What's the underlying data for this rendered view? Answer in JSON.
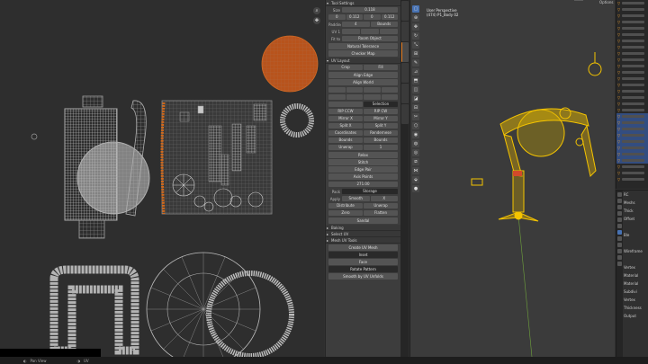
{
  "uv_editor": {
    "header_icons": [
      "zoom-icon",
      "pan-icon"
    ]
  },
  "n_panel": {
    "tool_header": "Tool Settings",
    "rows": [
      {
        "kind": "fields",
        "label": "Size",
        "values": [
          "0.118"
        ]
      },
      {
        "kind": "fields",
        "label": "",
        "values": [
          "0",
          "0.112",
          "0",
          "0.112"
        ]
      },
      {
        "kind": "fields",
        "label": "Padding",
        "values": [
          "4",
          "Bounds"
        ]
      },
      {
        "kind": "fields",
        "label": "UV 1",
        "values": [
          "",
          "",
          ""
        ]
      },
      {
        "kind": "fields",
        "label": "Fit to",
        "values": [
          "Room Object"
        ]
      },
      {
        "kind": "button",
        "label": "Natural Tolerance"
      },
      {
        "kind": "button",
        "label": "Checker Map"
      },
      {
        "kind": "header",
        "label": "UV Layout"
      },
      {
        "kind": "fields",
        "label": "",
        "values": [
          "Crop",
          "Fill"
        ]
      },
      {
        "kind": "button",
        "label": "Align Edge"
      },
      {
        "kind": "button",
        "label": "Align World"
      },
      {
        "kind": "fields",
        "label": "",
        "values": [
          "",
          "",
          "",
          ""
        ]
      },
      {
        "kind": "fields",
        "label": "",
        "values": [
          "",
          "",
          "",
          ""
        ]
      },
      {
        "kind": "fields",
        "label": "",
        "values": [
          "",
          "Selection"
        ]
      },
      {
        "kind": "fields",
        "label": "",
        "values": [
          "RIP CCW",
          "RIP CW"
        ]
      },
      {
        "kind": "fields",
        "label": "",
        "values": [
          "Mirror X",
          "Mirror Y"
        ]
      },
      {
        "kind": "fields",
        "label": "",
        "values": [
          "Split X",
          "Split Y"
        ]
      },
      {
        "kind": "fields",
        "label": "",
        "values": [
          "Coordinates",
          "Rendernese"
        ]
      },
      {
        "kind": "fields",
        "label": "",
        "values": [
          "Bounds",
          "Bounds"
        ]
      },
      {
        "kind": "fields",
        "label": "",
        "values": [
          "Unwrap",
          "1"
        ]
      },
      {
        "kind": "button",
        "label": "Relax"
      },
      {
        "kind": "button",
        "label": "Stitch"
      },
      {
        "kind": "button",
        "label": "Edge Pair"
      },
      {
        "kind": "button",
        "label": "Axis Points"
      },
      {
        "kind": "fields",
        "label": "",
        "values": [
          "271.00"
        ]
      },
      {
        "kind": "fields",
        "label": "Pack",
        "values": [
          "Storage"
        ]
      },
      {
        "kind": "fields",
        "label": "Apply",
        "values": [
          "Smooth",
          "X"
        ]
      },
      {
        "kind": "fields",
        "label": "",
        "values": [
          "Distribute",
          "Unwrap"
        ]
      },
      {
        "kind": "fields",
        "label": "",
        "values": [
          "Zero",
          "Flatten"
        ]
      },
      {
        "kind": "button",
        "label": "Sandal"
      },
      {
        "kind": "collapsed",
        "label": "Baking"
      },
      {
        "kind": "collapsed",
        "label": "Select UV"
      },
      {
        "kind": "collapsed",
        "label": "Mesh UV Tools"
      },
      {
        "kind": "button",
        "label": "Create UV Mesh"
      },
      {
        "kind": "dark",
        "label": "Inset"
      },
      {
        "kind": "button",
        "label": "Face"
      },
      {
        "kind": "dark",
        "label": "Rotate Pattern"
      },
      {
        "kind": "button",
        "label": "Smooth by UV Unfolds"
      }
    ]
  },
  "viewport": {
    "view_name": "User Perspective",
    "object_info": "(474) P1_Body 02",
    "options_label": "Options",
    "accent_color": "#f5c400"
  },
  "properties": {
    "rows": [
      "RC",
      "Meshs",
      "Thick",
      "Offset",
      "",
      "Ble",
      "",
      "Wireframe",
      "",
      "Vertex",
      "Material",
      "Material",
      "Subdivi",
      "Vertex",
      "Thickness",
      "Output"
    ]
  },
  "statusbar": {
    "mode": "Pan View",
    "hint": "UV"
  },
  "colors": {
    "uv_wire": "#b5b5b5",
    "uv_orange": "#c0581a",
    "panel_bg": "#3d3d3d",
    "selected": "#4772b3"
  }
}
